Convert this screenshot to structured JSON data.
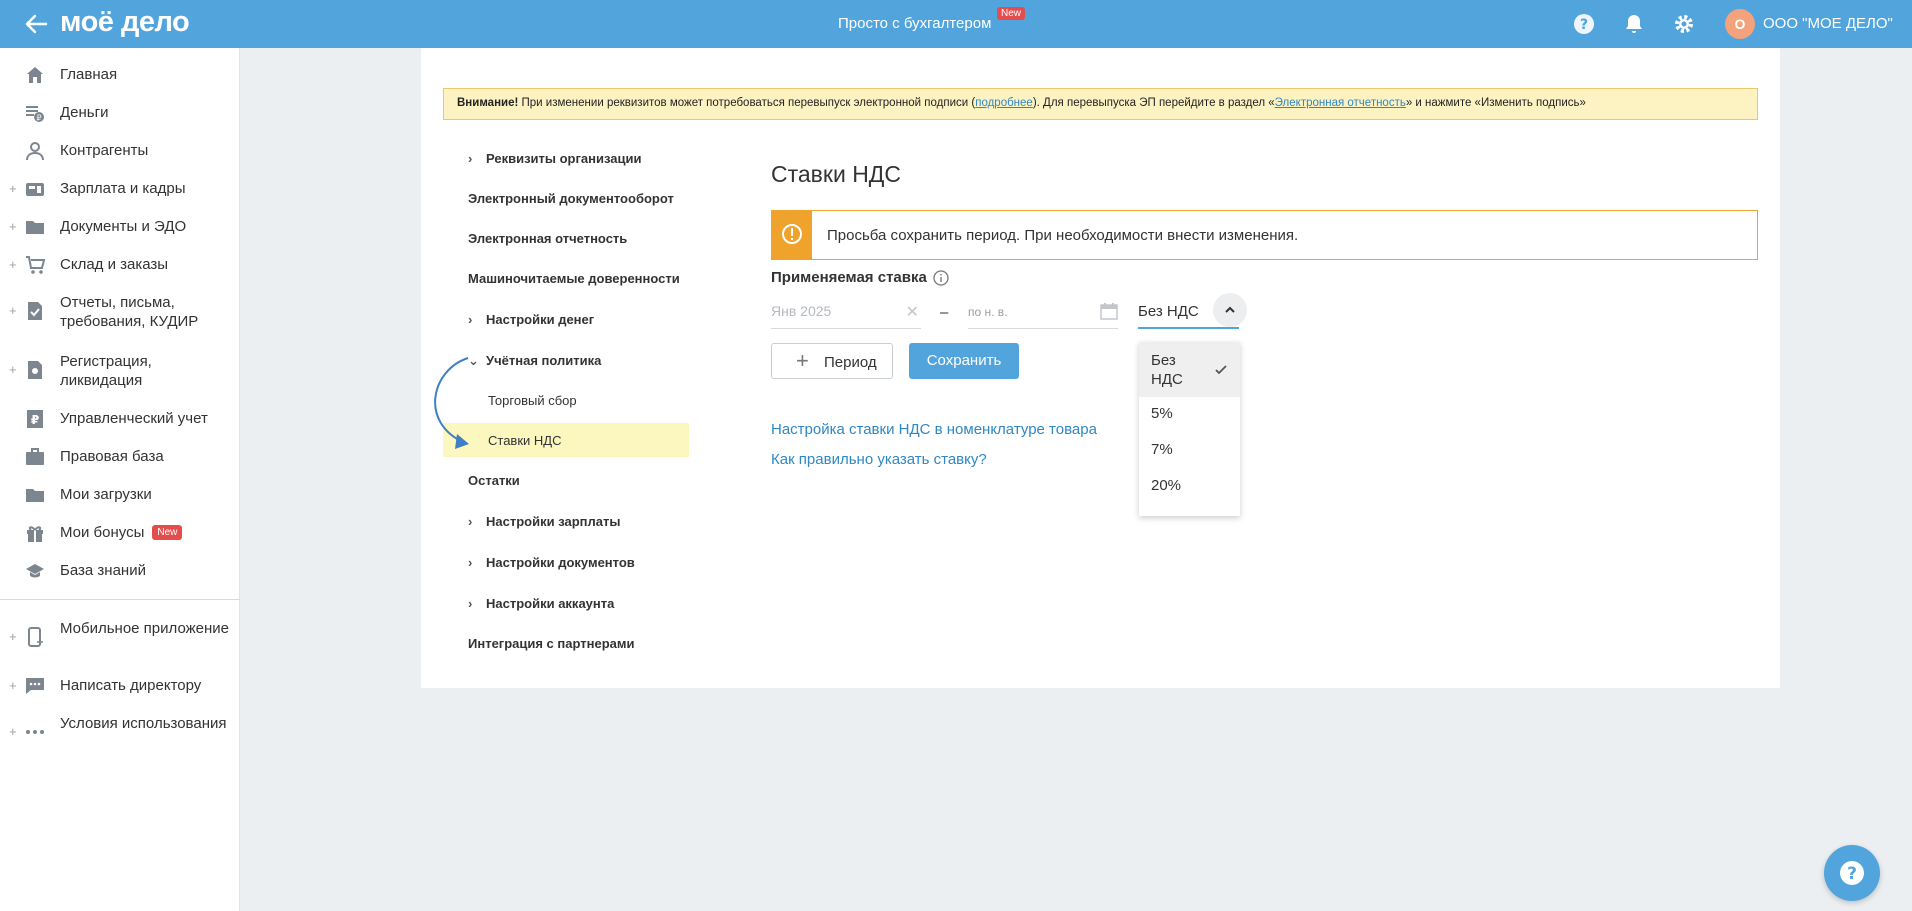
{
  "header": {
    "logo": "моё дело",
    "center_title": "Просто с бухгалтером",
    "center_badge": "New",
    "avatar_letter": "О",
    "org_name": "ООО \"МОЕ ДЕЛО\""
  },
  "sidebar": {
    "items": [
      {
        "label": "Главная"
      },
      {
        "label": "Деньги"
      },
      {
        "label": "Контрагенты"
      },
      {
        "label": "Зарплата и кадры"
      },
      {
        "label": "Документы и ЭДО"
      },
      {
        "label": "Склад и заказы"
      },
      {
        "label": "Отчеты, письма, требования, КУДИР"
      },
      {
        "label": "Регистрация, ликвидация"
      },
      {
        "label": "Управленческий учет"
      },
      {
        "label": "Правовая база"
      },
      {
        "label": "Мои загрузки"
      },
      {
        "label": "Мои бонусы",
        "badge": "New"
      },
      {
        "label": "База знаний"
      },
      {
        "label": "Мобильное приложение"
      },
      {
        "label": "Написать директору"
      },
      {
        "label": "Условия использования"
      }
    ]
  },
  "warning": {
    "bold": "Внимание!",
    "text1": " При изменении реквизитов может потребоваться перевыпуск электронной подписи (",
    "link1": "подробнее",
    "text2": "). Для перевыпуска ЭП перейдите в раздел «",
    "link2": "Электронная отчетность",
    "text3": "» и нажмите «Изменить подпись»"
  },
  "settings_menu": {
    "requisites": "Реквизиты организации",
    "edo": "Электронный документооборот",
    "reporting": "Электронная отчетность",
    "poa": "Машиночитаемые доверенности",
    "money": "Настройки денег",
    "policy": "Учётная политика",
    "trade_fee": "Торговый сбор",
    "vat_rates": "Ставки НДС",
    "balances": "Остатки",
    "salary": "Настройки зарплаты",
    "documents": "Настройки документов",
    "account": "Настройки аккаунта",
    "integration": "Интеграция с партнерами"
  },
  "content": {
    "title": "Ставки НДС",
    "alert": "Просьба сохранить период. При необходимости внести изменения.",
    "rate_label": "Применяемая ставка",
    "from_value": "Янв 2025",
    "to_placeholder": "по н. в.",
    "selected_rate": "Без НДС",
    "add_period": "Период",
    "save": "Сохранить",
    "link_nomenclature": "Настройка ставки НДС в номенклатуре товара",
    "link_howto": "Как правильно указать ставку?"
  },
  "dropdown": {
    "options": [
      "Без НДС",
      "5%",
      "7%",
      "20%"
    ],
    "selected_index": 0
  },
  "colors": {
    "brand": "#52a4dc",
    "warning_bg": "#fdf3c2",
    "alert_accent": "#f0a32c",
    "active_bg": "#fcf6bf",
    "badge": "#e54d4d"
  }
}
